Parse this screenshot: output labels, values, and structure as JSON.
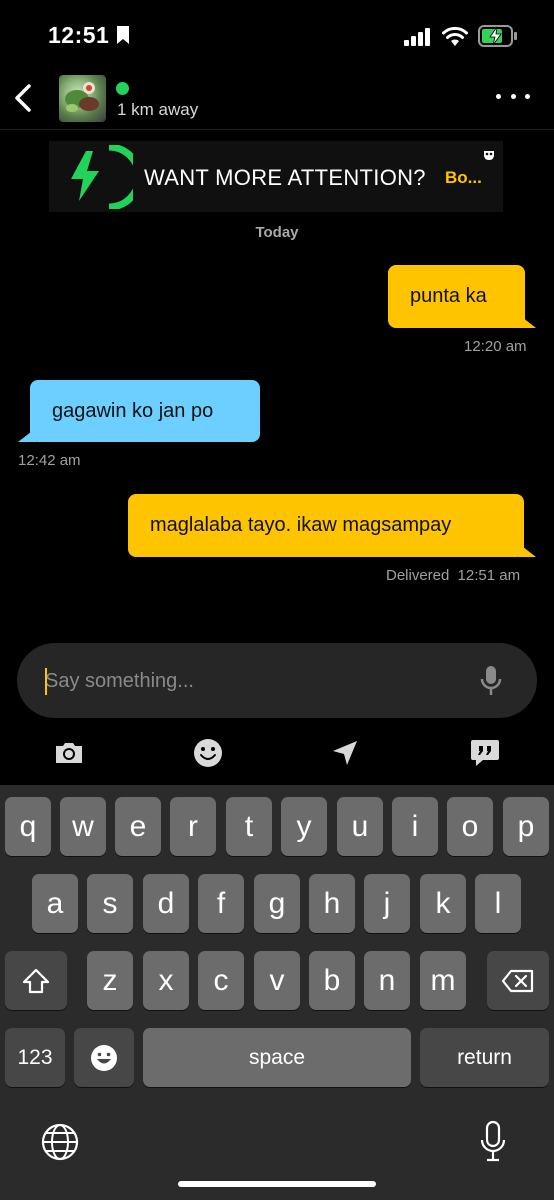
{
  "status_bar": {
    "time": "12:51"
  },
  "header": {
    "distance": "1 km away",
    "online_color": "#22d35a"
  },
  "promo": {
    "text": "WANT MORE ATTENTION?",
    "cta": "Bo..."
  },
  "chat": {
    "date_separator": "Today",
    "messages": [
      {
        "direction": "sent",
        "text": "punta ka",
        "time": "12:20 am"
      },
      {
        "direction": "received",
        "text": "gagawin ko jan po",
        "time": "12:42 am"
      },
      {
        "direction": "sent",
        "text": "maglalaba tayo. ikaw magsampay",
        "status": "Delivered",
        "time": "12:51 am"
      }
    ]
  },
  "composer": {
    "placeholder": "Say something..."
  },
  "toolbar": {
    "icons": [
      "camera-icon",
      "emoji-icon",
      "location-arrow-icon",
      "quote-bubble-icon"
    ]
  },
  "keyboard": {
    "row1": [
      "q",
      "w",
      "e",
      "r",
      "t",
      "y",
      "u",
      "i",
      "o",
      "p"
    ],
    "row2": [
      "a",
      "s",
      "d",
      "f",
      "g",
      "h",
      "j",
      "k",
      "l"
    ],
    "row3": [
      "z",
      "x",
      "c",
      "v",
      "b",
      "n",
      "m"
    ],
    "numbers_label": "123",
    "space_label": "space",
    "return_label": "return"
  },
  "colors": {
    "sent_bubble": "#ffc400",
    "received_bubble": "#6ccfff",
    "accent_green": "#22d35a"
  }
}
